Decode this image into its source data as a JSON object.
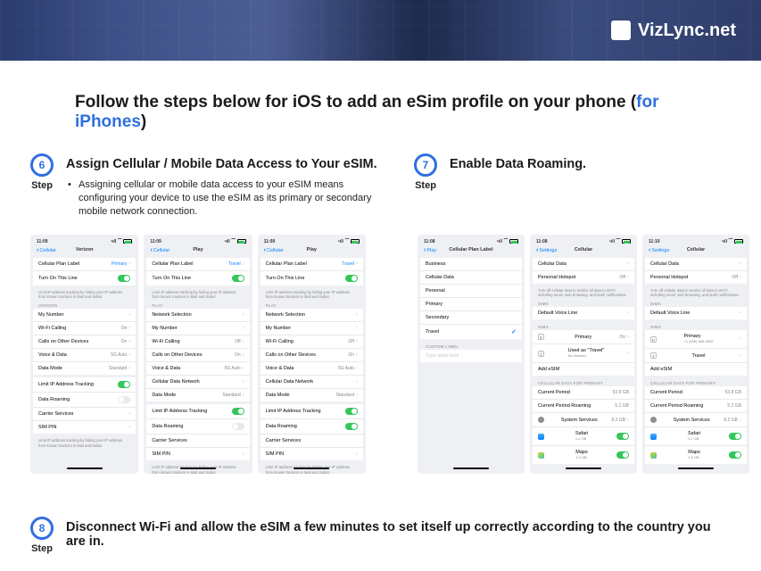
{
  "brand": "VizLync.net",
  "headline_pre": "Follow the steps below for iOS to add an eSim profile on your phone (",
  "headline_link": "for iPhones",
  "headline_post": ")",
  "step_word": "Step",
  "step6": {
    "num": "6",
    "title": "Assign Cellular / Mobile Data Access to Your eSIM.",
    "desc": "Assigning cellular or mobile data access to your eSIM means configuring your device to use the eSIM as its primary or secondary mobile network connection."
  },
  "step7": {
    "num": "7",
    "title": "Enable Data Roaming."
  },
  "step8": {
    "num": "8",
    "title": "Disconnect Wi-Fi and allow the eSIM a few minutes to set itself up correctly according to the country you are in."
  },
  "shots6": {
    "a": {
      "time": "11:09",
      "back": "Cellular",
      "title": "Verizon",
      "rows": [
        {
          "l": "Cellular Plan Label",
          "v": "Primary",
          "chev": 1,
          "blue": 1
        },
        {
          "l": "Turn On This Line",
          "toggle": "on"
        }
      ],
      "sec": "VERIZON",
      "rows2": [
        {
          "l": "My Number",
          "v": "",
          "chev": 1
        },
        {
          "l": "Wi-Fi Calling",
          "v": "On",
          "chev": 1
        },
        {
          "l": "Calls on Other Devices",
          "v": "On",
          "chev": 1
        },
        {
          "l": "Voice & Data",
          "v": "5G Auto",
          "chev": 1
        },
        {
          "l": "Data Mode",
          "v": "Standard",
          "chev": 1
        }
      ],
      "rows3": [
        {
          "l": "Limit IP Address Tracking",
          "toggle": "on"
        },
        {
          "l": "Data Roaming",
          "toggle": "off"
        },
        {
          "l": "Carrier Services",
          "chev": 1
        },
        {
          "l": "SIM PIN",
          "chev": 1
        }
      ],
      "note": "Limit IP address tracking by hiding your IP address from known trackers in Mail and Safari."
    },
    "b": {
      "time": "11:09",
      "back": "Cellular",
      "title": "Play",
      "rows": [
        {
          "l": "Cellular Plan Label",
          "v": "Travel",
          "chev": 1,
          "blue": 1
        },
        {
          "l": "Turn On This Line",
          "toggle": "on"
        }
      ],
      "sec": "PLAY",
      "rows2": [
        {
          "l": "Network Selection",
          "v": "",
          "chev": 1
        },
        {
          "l": "My Number",
          "v": "",
          "chev": 1
        },
        {
          "l": "Wi-Fi Calling",
          "v": "Off",
          "chev": 1
        },
        {
          "l": "Calls on Other Devices",
          "v": "On",
          "chev": 1
        },
        {
          "l": "Voice & Data",
          "v": "5G Auto",
          "chev": 1
        },
        {
          "l": "Cellular Data Network",
          "chev": 1
        },
        {
          "l": "Data Mode",
          "v": "Standard",
          "chev": 1
        }
      ],
      "rows3": [
        {
          "l": "Limit IP Address Tracking",
          "toggle": "on"
        },
        {
          "l": "Data Roaming",
          "toggle": "off"
        },
        {
          "l": "Carrier Services",
          "link": 1
        },
        {
          "l": "SIM PIN",
          "chev": 1
        }
      ],
      "note": "Limit IP address tracking by hiding your IP address from known trackers in Mail and Safari."
    },
    "c": {
      "time": "11:09",
      "back": "Cellular",
      "title": "Play",
      "rows": [
        {
          "l": "Cellular Plan Label",
          "v": "Travel",
          "chev": 1,
          "blue": 1
        },
        {
          "l": "Turn On This Line",
          "toggle": "on"
        }
      ],
      "sec": "PLAY",
      "rows2": [
        {
          "l": "Network Selection",
          "v": "",
          "chev": 1
        },
        {
          "l": "My Number",
          "v": "",
          "chev": 1
        },
        {
          "l": "Wi-Fi Calling",
          "v": "Off",
          "chev": 1
        },
        {
          "l": "Calls on Other Devices",
          "v": "On",
          "chev": 1
        },
        {
          "l": "Voice & Data",
          "v": "5G Auto",
          "chev": 1
        },
        {
          "l": "Cellular Data Network",
          "chev": 1
        },
        {
          "l": "Data Mode",
          "v": "Standard",
          "chev": 1
        }
      ],
      "rows3": [
        {
          "l": "Limit IP Address Tracking",
          "toggle": "on"
        },
        {
          "l": "Data Roaming",
          "toggle": "on"
        },
        {
          "l": "Carrier Services",
          "link": 1
        },
        {
          "l": "SIM PIN",
          "chev": 1
        }
      ],
      "note": "Limit IP address tracking by hiding your IP address from known trackers in Mail and Safari."
    }
  },
  "shots7": {
    "a": {
      "time": "11:08",
      "back": "Play",
      "title": "Cellular Plan Label",
      "rows": [
        {
          "l": "Business"
        },
        {
          "l": "Cellular Data"
        },
        {
          "l": "Personal"
        },
        {
          "l": "Primary"
        },
        {
          "l": "Secondary"
        },
        {
          "l": "Travel",
          "check": 1
        }
      ],
      "sec": "CUSTOM LABEL",
      "rows2": [
        {
          "l": "",
          "ph": "Type label here"
        }
      ]
    },
    "b": {
      "time": "11:08",
      "back": "Settings",
      "title": "Cellular",
      "rows": [
        {
          "l": "Cellular Data",
          "chev": 1
        },
        {
          "l": "Personal Hotspot",
          "v": "Off",
          "chev": 1
        }
      ],
      "note": "Turn off cellular data to restrict all data to Wi-Fi, including email, web browsing, and push notifications.",
      "rows2": [
        {
          "l": "Default Voice Line",
          "chev": 1
        }
      ],
      "sec": "SIMs",
      "rows3": [
        {
          "l": "Primary",
          "v": "On",
          "chev": 1,
          "badge": "p"
        },
        {
          "l": "Used as \"Travel\"",
          "sub": "No Number",
          "chev": 1,
          "badge": "t"
        },
        {
          "l": "Add eSIM",
          "link": 1
        }
      ],
      "sec2": "CELLULAR DATA FOR PRIMARY",
      "rows4": [
        {
          "l": "Current Period",
          "v": "53.8 GB"
        },
        {
          "l": "Current Period Roaming",
          "v": "5.2 GB"
        },
        {
          "l": "System Services",
          "v": "8.2 GB",
          "chev": 1,
          "gear": 1
        },
        {
          "l": "Safari",
          "toggle": "on",
          "app": "safari",
          "sub": "1.2 GB"
        },
        {
          "l": "Maps",
          "toggle": "on",
          "app": "maps",
          "sub": "1.0 GB"
        }
      ]
    },
    "c": {
      "time": "11:10",
      "back": "Settings",
      "title": "Cellular",
      "rows": [
        {
          "l": "Cellular Data",
          "chev": 1
        },
        {
          "l": "Personal Hotspot",
          "v": "Off",
          "chev": 1
        }
      ],
      "note": "Turn off cellular data to restrict all data to Wi-Fi, including email, web browsing, and push notifications.",
      "rows2": [
        {
          "l": "Default Voice Line",
          "chev": 1
        }
      ],
      "sec": "SIMs",
      "rows3": [
        {
          "l": "Primary",
          "chev": 1,
          "badge": "p",
          "sub": "+1 (555) 555-5555"
        },
        {
          "l": "Travel",
          "chev": 1,
          "badge": "t"
        },
        {
          "l": "Add eSIM",
          "link": 1
        }
      ],
      "sec2": "CELLULAR DATA FOR PRIMARY",
      "rows4": [
        {
          "l": "Current Period",
          "v": "53.8 GB"
        },
        {
          "l": "Current Period Roaming",
          "v": "5.2 GB"
        },
        {
          "l": "System Services",
          "v": "8.2 GB",
          "chev": 1,
          "gear": 1
        },
        {
          "l": "Safari",
          "toggle": "on",
          "app": "safari",
          "sub": "1.2 GB"
        },
        {
          "l": "Maps",
          "toggle": "on",
          "app": "maps",
          "sub": "1.0 GB"
        }
      ]
    }
  }
}
